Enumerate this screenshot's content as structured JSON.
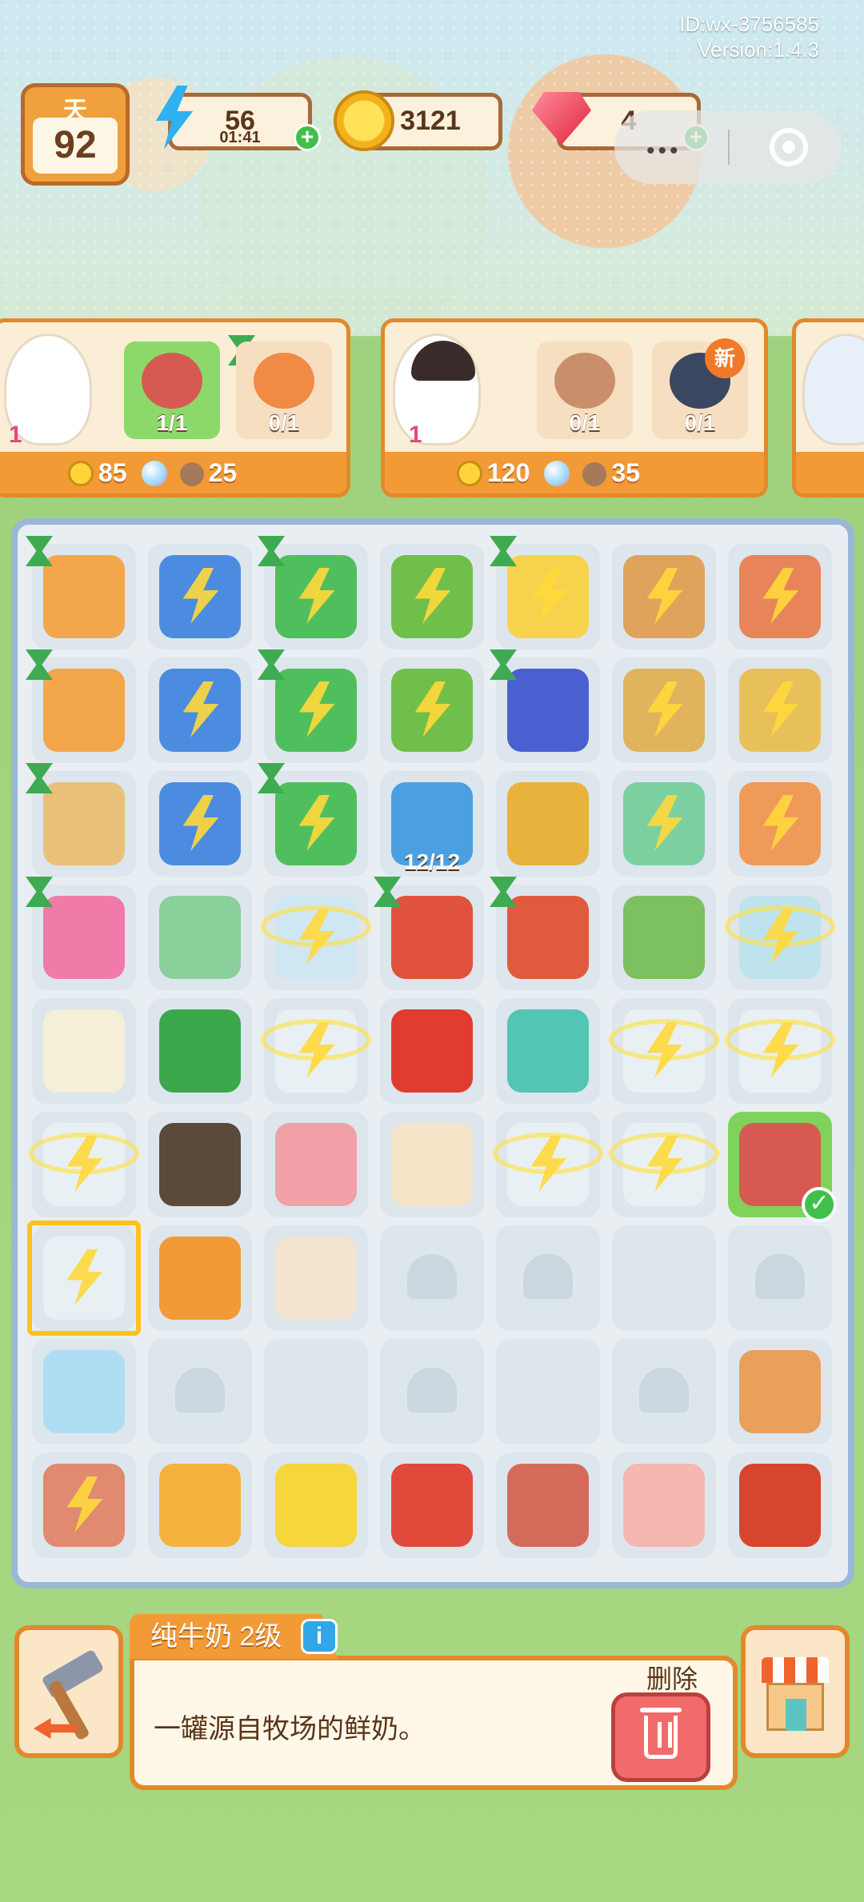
{
  "meta": {
    "id": "ID:wx-3756585",
    "version": "Version:1.4.3"
  },
  "topbar": {
    "day_label": "天",
    "day": "92",
    "energy": "56",
    "energy_timer": "01:41",
    "coins": "3121",
    "gems": "4",
    "plus": "+"
  },
  "capsule": {
    "more_icon": "more-dots-icon",
    "close_icon": "target-ring-icon"
  },
  "orders": [
    {
      "hearts": "1",
      "items": [
        {
          "count": "1/1",
          "done": true
        },
        {
          "count": "0/1",
          "done": false
        }
      ],
      "reward_coins": "85",
      "reward_bag": "25"
    },
    {
      "hearts": "1",
      "items": [
        {
          "count": "0/1",
          "done": false
        },
        {
          "count": "0/1",
          "done": false,
          "badge": "新"
        }
      ],
      "reward_coins": "120",
      "reward_bag": "35"
    }
  ],
  "board": {
    "stock_label": "12/12"
  },
  "selected": {
    "name": "纯牛奶 2级",
    "info_icon": "i",
    "description": "一罐源自牧场的鲜奶。",
    "delete_label": "删除"
  },
  "colors": {
    "accent": "#f29a36",
    "board_border": "#9ab7d6",
    "selected": "#7fd25a"
  }
}
